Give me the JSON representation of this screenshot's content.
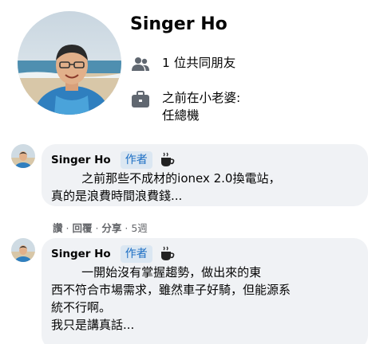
{
  "profile": {
    "name": "Singer Ho",
    "mutual_friends": "1 位共同朋友",
    "work_line1": "之前在小老婆:",
    "work_line2": "任總機",
    "icons": {
      "friends": "people-icon",
      "work": "briefcase-icon"
    }
  },
  "comments": [
    {
      "author": "Singer Ho",
      "badge": "作者",
      "text": "        之前那些不成材的ionex 2.0換電站，\n真的是浪費時間浪費錢...",
      "actions": {
        "like": "讚",
        "reply": "回覆",
        "share": "分享",
        "time": "5週"
      }
    },
    {
      "author": "Singer Ho",
      "badge": "作者",
      "text": "        一開始沒有掌握趨勢，做出來的東\n西不符合市場需求，雖然車子好騎，但能源系\n統不行啊。\n我只是講真話...",
      "actions": {}
    }
  ],
  "colors": {
    "bubble": "#f0f2f5",
    "badge_bg": "#dbe7f2",
    "badge_text": "#1d6fc4",
    "meta": "#65676b"
  }
}
